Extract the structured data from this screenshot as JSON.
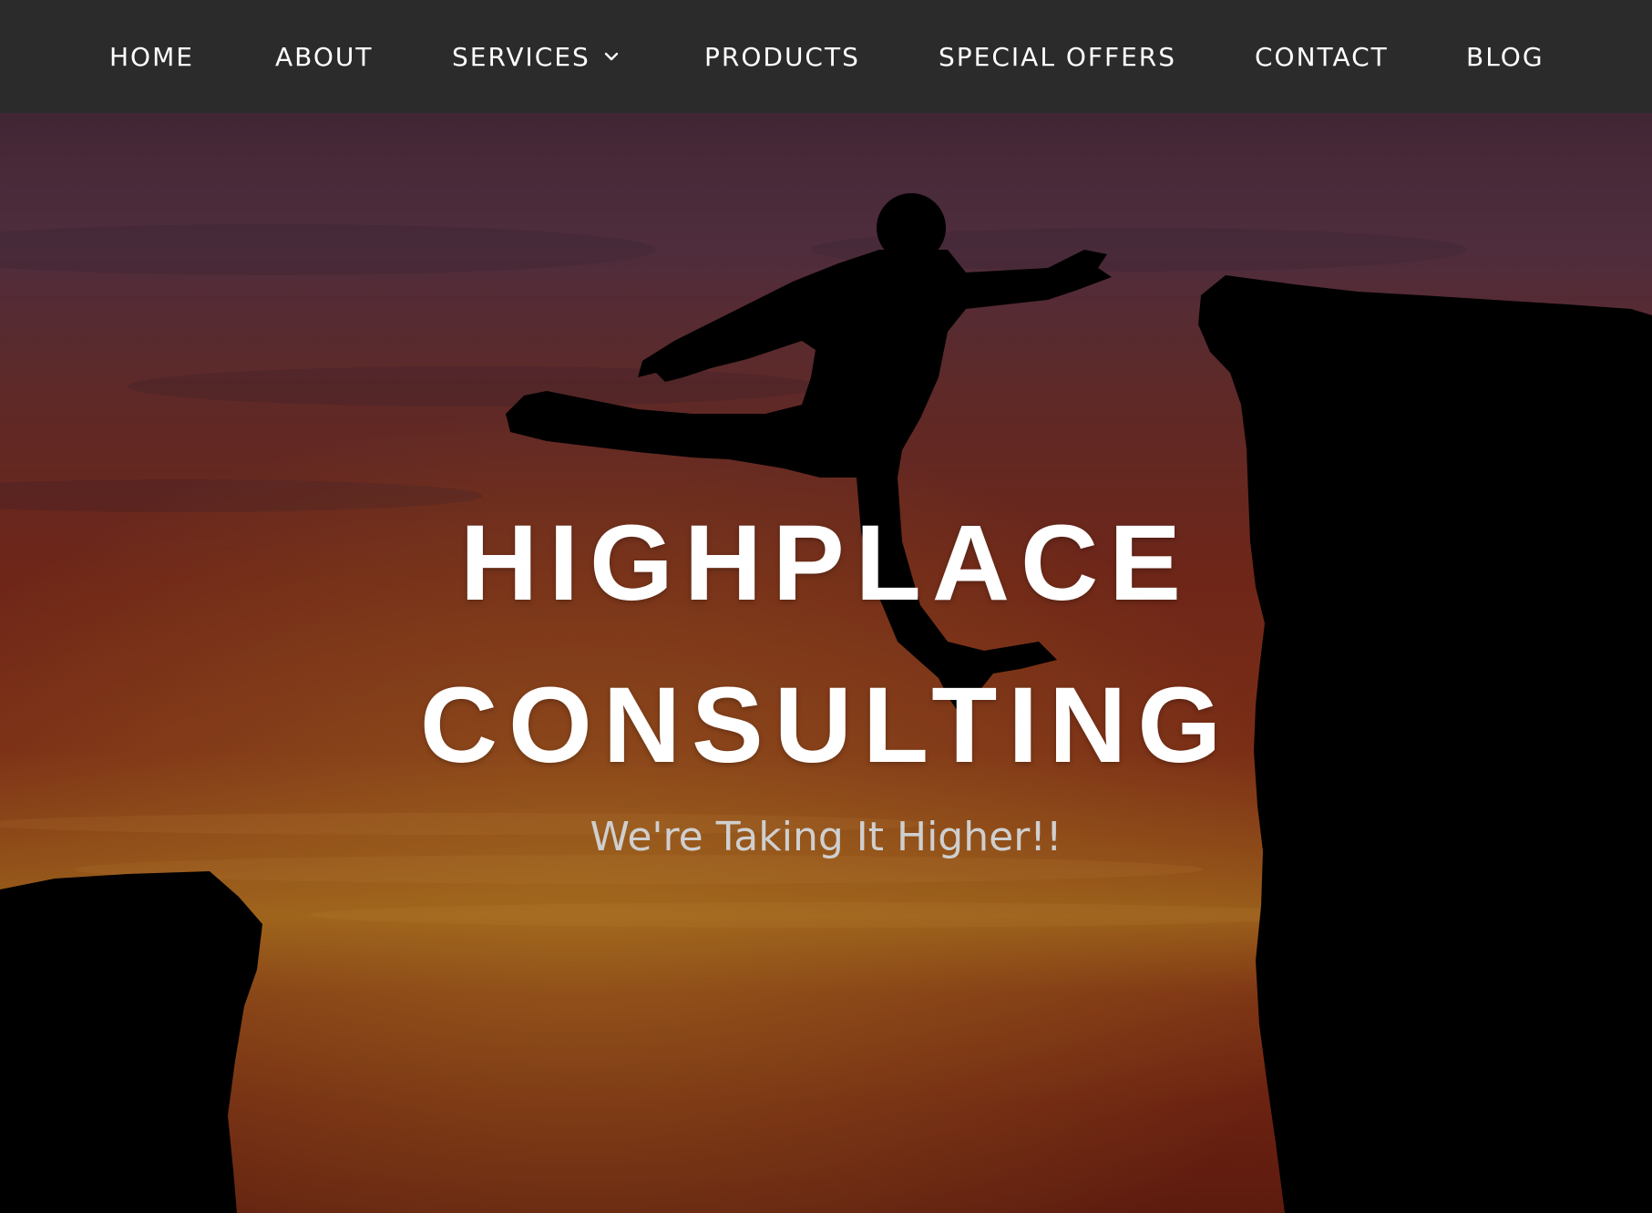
{
  "nav": {
    "items": [
      {
        "label": "HOME"
      },
      {
        "label": "ABOUT"
      },
      {
        "label": "SERVICES",
        "has_dropdown": true,
        "icon": "chevron-down-icon"
      },
      {
        "label": "PRODUCTS"
      },
      {
        "label": "SPECIAL OFFERS"
      },
      {
        "label": "CONTACT"
      },
      {
        "label": "BLOG"
      }
    ],
    "background": "#2b2b2b",
    "text_color": "#ffffff"
  },
  "hero": {
    "title_line1": "HIGHPLACE",
    "title_line2": "CONSULTING",
    "tagline": "We're Taking It Higher!!",
    "image": "silhouette of a person leaping between two cliffs against an orange sunset sky",
    "colors": {
      "sky_top": "#4a2f45",
      "sky_mid": "#8a2e1c",
      "sky_glow": "#b9701e",
      "silhouette": "#000000"
    }
  }
}
